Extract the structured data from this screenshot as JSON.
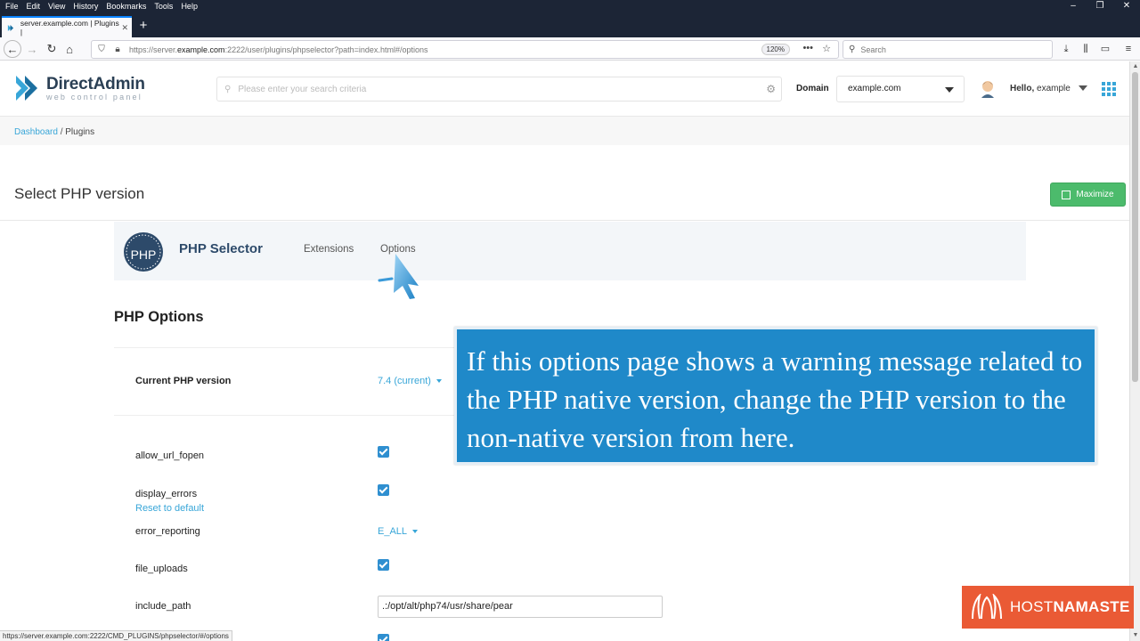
{
  "browser": {
    "menu": [
      "File",
      "Edit",
      "View",
      "History",
      "Bookmarks",
      "Tools",
      "Help"
    ],
    "window_controls": [
      "minimize",
      "restore",
      "close"
    ],
    "tab_title": "server.example.com | Plugins |",
    "url_prefix": "https://server.",
    "url_domain": "example.com",
    "url_rest": ":2222/user/plugins/phpselector?path=index.html#/options",
    "zoom": "120%",
    "search_placeholder": "Search",
    "status_url": "https://server.example.com:2222/CMD_PLUGINS/phpselector/#/options"
  },
  "header": {
    "brand": "DirectAdmin",
    "brand_sub": "web control panel",
    "search_placeholder": "Please enter your search criteria",
    "domain_label": "Domain",
    "domain_value": "example.com",
    "hello_prefix": "Hello,",
    "username": "example"
  },
  "breadcrumb": {
    "items": [
      "Dashboard",
      "Plugins"
    ],
    "separator": "/"
  },
  "page": {
    "title": "Select PHP version",
    "maximize_label": "Maximize"
  },
  "plugin": {
    "logo_text": "PHP",
    "name": "PHP Selector",
    "tabs": [
      "Extensions",
      "Options"
    ],
    "active_tab": "Options"
  },
  "options": {
    "title": "PHP Options",
    "current_version_label": "Current PHP version",
    "current_version_value": "7.4 (current)",
    "rows": [
      {
        "name": "allow_url_fopen",
        "type": "checkbox",
        "checked": true
      },
      {
        "name": "display_errors",
        "type": "checkbox",
        "checked": true,
        "reset_link": "Reset to default"
      },
      {
        "name": "error_reporting",
        "type": "select",
        "value": "E_ALL"
      },
      {
        "name": "file_uploads",
        "type": "checkbox",
        "checked": true
      },
      {
        "name": "include_path",
        "type": "text",
        "value": ".:/opt/alt/php74/usr/share/pear"
      }
    ]
  },
  "callout": {
    "text": "If this options page shows a warning message related to the PHP native version, change the PHP version to the non-native version from here."
  },
  "watermark": {
    "text_light": "HOST",
    "text_bold": "NAMASTE"
  },
  "colors": {
    "accent": "#38a6d8",
    "maximize_green": "#4cbb6c",
    "callout_blue": "#1f89c9",
    "badge_orange": "#ea5a35",
    "browser_chrome": "#1c2536"
  }
}
